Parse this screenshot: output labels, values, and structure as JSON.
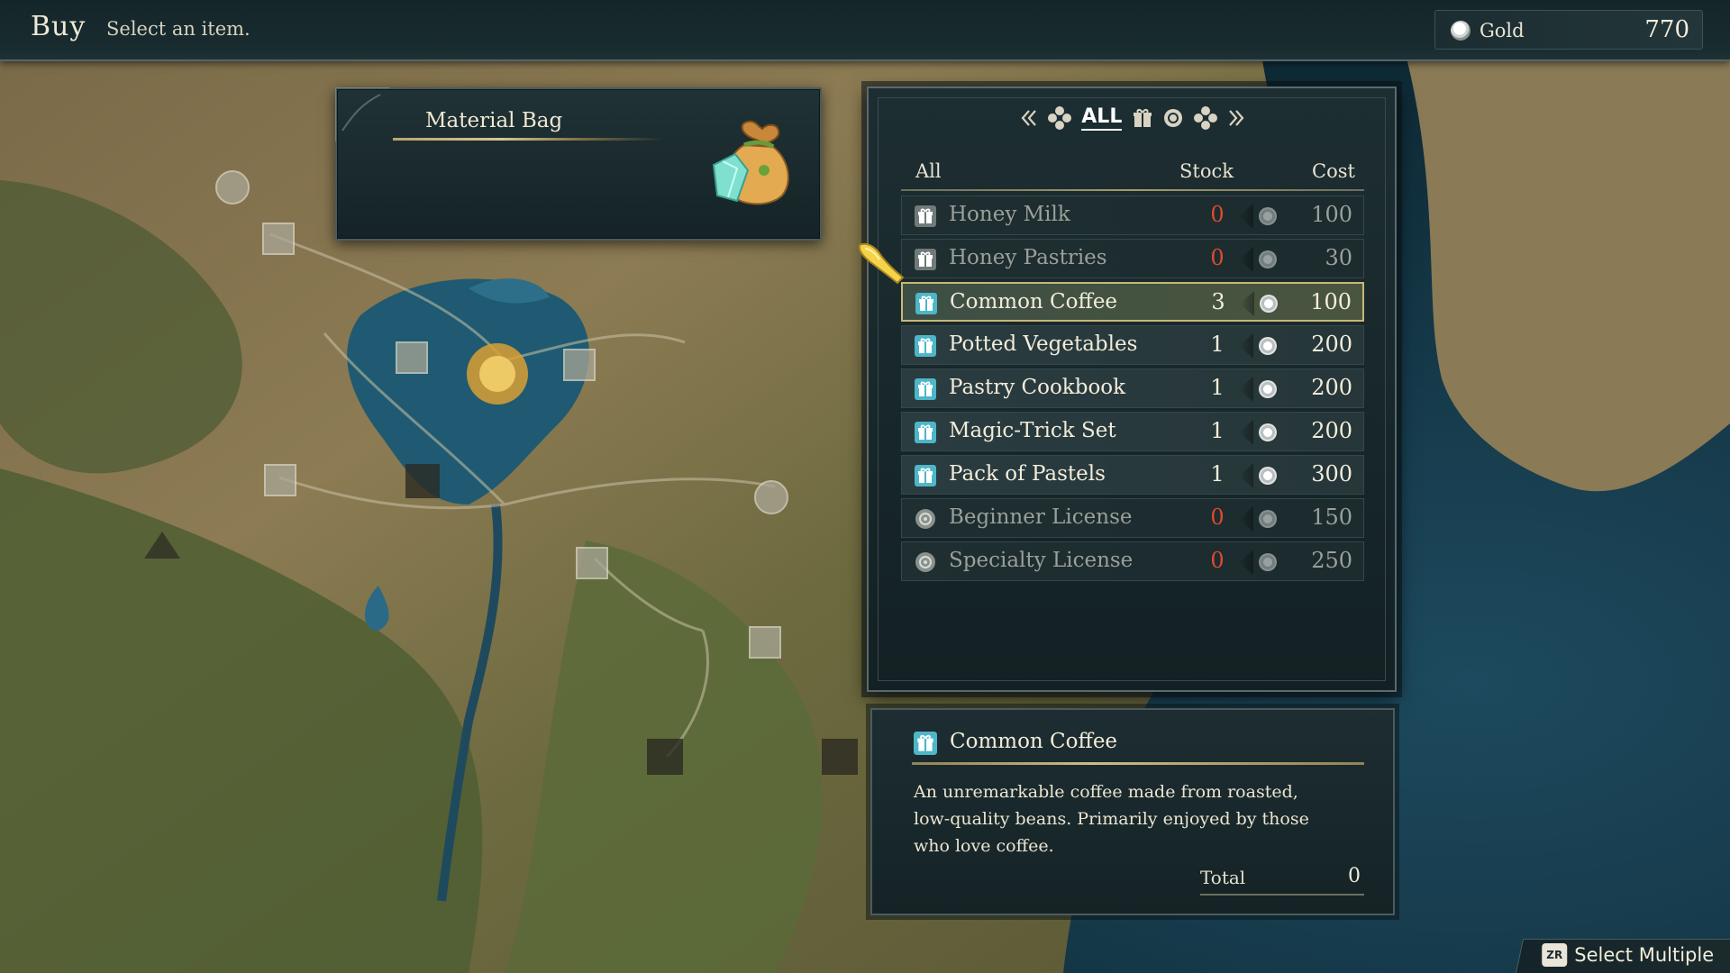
{
  "header": {
    "mode_title": "Buy",
    "hint": "Select an item."
  },
  "wallet": {
    "label": "Gold",
    "value": "770",
    "icon": "silver-coin-icon"
  },
  "bag": {
    "title": "Material Bag",
    "icon": "material-bag-icon"
  },
  "shop": {
    "tabs": [
      {
        "icon": "chevron-left-icon",
        "active": false
      },
      {
        "icon": "flower-category-icon",
        "active": false
      },
      {
        "label": "ALL",
        "active": true
      },
      {
        "icon": "gift-category-icon",
        "active": false
      },
      {
        "icon": "seal-category-icon",
        "active": false
      },
      {
        "icon": "flower-category-icon",
        "active": false
      },
      {
        "icon": "chevron-right-icon",
        "active": false
      }
    ],
    "columns": {
      "name": "All",
      "stock": "Stock",
      "cost": "Cost"
    },
    "items": [
      {
        "name": "Honey Milk",
        "stock": "0",
        "cost": "100",
        "icon": "gift-icon",
        "available": false,
        "selected": false
      },
      {
        "name": "Honey Pastries",
        "stock": "0",
        "cost": "30",
        "icon": "gift-icon",
        "available": false,
        "selected": false
      },
      {
        "name": "Common Coffee",
        "stock": "3",
        "cost": "100",
        "icon": "gift-icon",
        "available": true,
        "selected": true
      },
      {
        "name": "Potted Vegetables",
        "stock": "1",
        "cost": "200",
        "icon": "gift-icon",
        "available": true,
        "selected": false
      },
      {
        "name": "Pastry Cookbook",
        "stock": "1",
        "cost": "200",
        "icon": "gift-icon",
        "available": true,
        "selected": false
      },
      {
        "name": "Magic-Trick Set",
        "stock": "1",
        "cost": "200",
        "icon": "gift-icon",
        "available": true,
        "selected": false
      },
      {
        "name": "Pack of Pastels",
        "stock": "1",
        "cost": "300",
        "icon": "gift-icon",
        "available": true,
        "selected": false
      },
      {
        "name": "Beginner License",
        "stock": "0",
        "cost": "150",
        "icon": "license-seal-icon",
        "available": false,
        "selected": false
      },
      {
        "name": "Specialty License",
        "stock": "0",
        "cost": "250",
        "icon": "license-seal-icon",
        "available": false,
        "selected": false
      }
    ]
  },
  "detail": {
    "title": "Common Coffee",
    "icon": "gift-icon",
    "description": "An unremarkable coffee made from roasted, low-quality beans. Primarily enjoyed by those who love coffee.",
    "total_label": "Total",
    "total_value": "0"
  },
  "footer": {
    "button_key": "ZR",
    "button_label": "Select Multiple"
  },
  "colors": {
    "out_of_stock": "#e04a2e",
    "selection_border": "#c8b77a",
    "panel": "#1d2e32"
  }
}
